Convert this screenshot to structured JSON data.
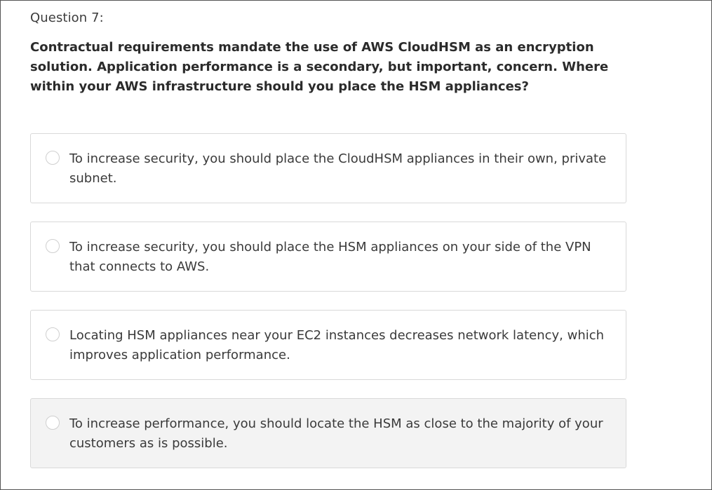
{
  "question": {
    "number_label": "Question 7:",
    "text": "Contractual requirements mandate the use of AWS CloudHSM as an encryption solution. Application performance is a secondary, but important, concern. Where within your AWS infrastructure should you place the HSM appliances?"
  },
  "answers": [
    {
      "text": "To increase security, you should place the CloudHSM appliances in their own, private subnet.",
      "selected": false
    },
    {
      "text": "To increase security, you should place the HSM appliances on your side of the VPN that connects to AWS.",
      "selected": false
    },
    {
      "text": "Locating HSM appliances near your EC2 instances decreases network latency, which improves application performance.",
      "selected": false
    },
    {
      "text": "To increase performance, you should locate the HSM as close to the majority of your customers as is possible.",
      "selected": false
    }
  ],
  "colors": {
    "border": "#d9d9d9",
    "hover_background": "#f3f3f3",
    "text": "#3a3a3a"
  }
}
